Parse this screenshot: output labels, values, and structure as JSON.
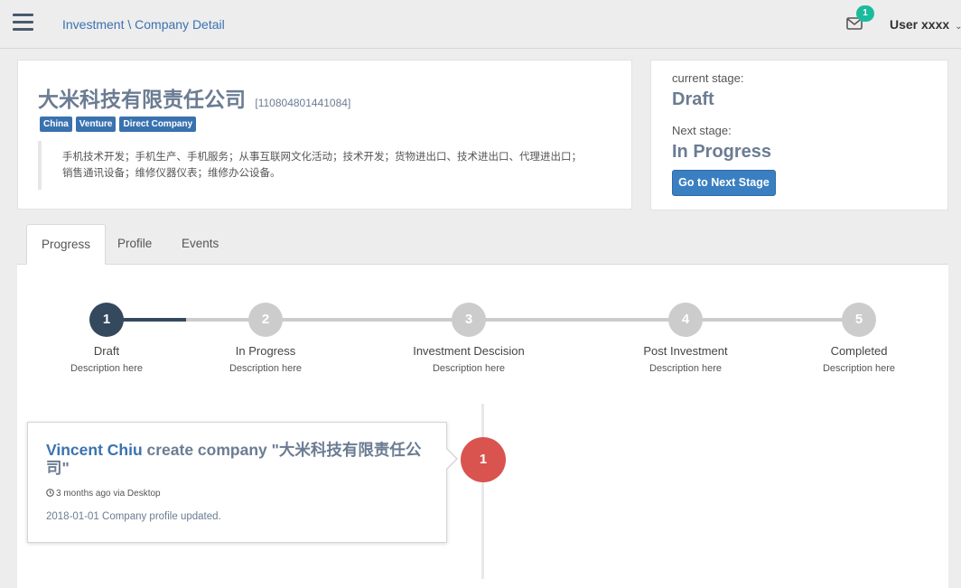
{
  "header": {
    "breadcrumb": "Investment \\ Company Detail",
    "notification_count": "1",
    "user_name": "User xxxx",
    "user_chevron": "⌄"
  },
  "company": {
    "name": "大米科技有限责任公司",
    "id": "[110804801441084]",
    "tags": [
      "China",
      "Venture",
      "Direct Company"
    ],
    "description": "手机技术开发；手机生产、手机服务；从事互联网文化活动；技术开发；货物进出口、技术进出口、代理进出口；销售通讯设备；维修仪器仪表；维修办公设备。"
  },
  "stage": {
    "current_label": "current stage:",
    "current_value": "Draft",
    "next_label": "Next stage:",
    "next_value": "In Progress",
    "button_label": "Go to Next Stage"
  },
  "tabs": [
    {
      "label": "Progress",
      "active": true
    },
    {
      "label": "Profile",
      "active": false
    },
    {
      "label": "Events",
      "active": false
    }
  ],
  "steps": [
    {
      "number": "1",
      "title": "Draft",
      "description": "Description here",
      "state": "done"
    },
    {
      "number": "2",
      "title": "In Progress",
      "description": "Description here",
      "state": "pending"
    },
    {
      "number": "3",
      "title": "Investment Descision",
      "description": "Description here",
      "state": "pending"
    },
    {
      "number": "4",
      "title": "Post Investment",
      "description": "Description here",
      "state": "pending"
    },
    {
      "number": "5",
      "title": "Completed",
      "description": "Description here",
      "state": "pending"
    }
  ],
  "timeline": {
    "author": "Vincent Chiu",
    "action": " create company \"大米科技有限责任公司\"",
    "meta": "3 months ago via Desktop",
    "body": "2018-01-01 Company profile updated.",
    "badge": "1"
  },
  "colors": {
    "accent": "#3a72b0",
    "step_active": "#34495e",
    "step_pending": "#cccccc",
    "timeline_badge": "#d9534f",
    "notification_badge": "#1abc9c"
  },
  "icons": {
    "menu": "hamburger-icon",
    "mail": "mail-icon",
    "clock": "clock-icon",
    "user_menu": "chevron-down-icon"
  }
}
